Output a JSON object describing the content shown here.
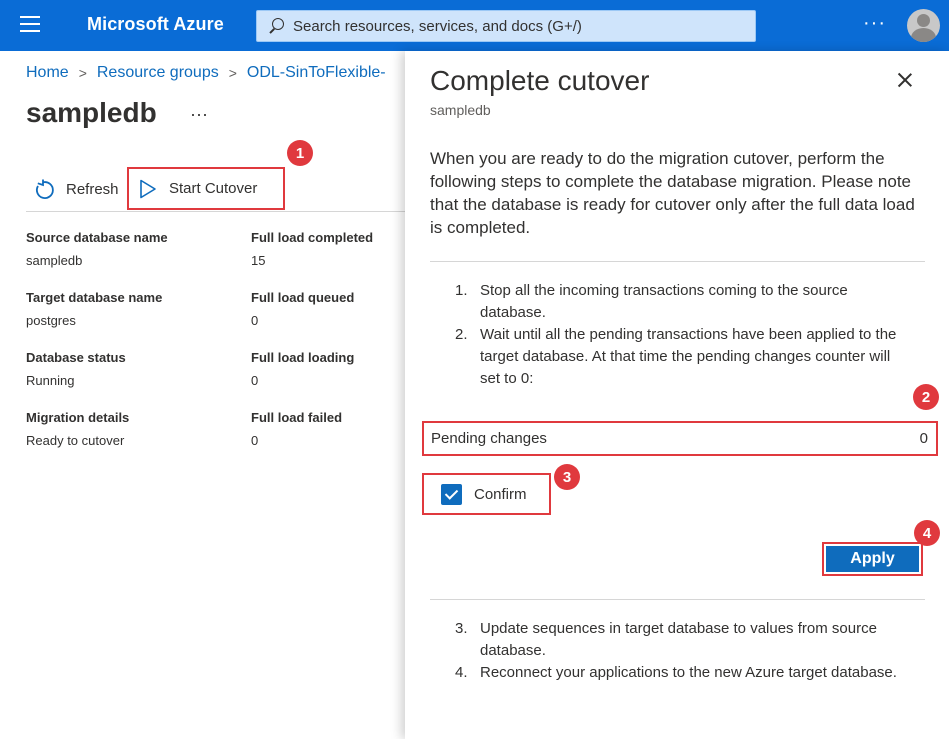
{
  "topbar": {
    "brand": "Microsoft Azure",
    "search_placeholder": "Search resources, services, and docs (G+/)",
    "more": "···"
  },
  "breadcrumb": [
    "Home",
    "Resource groups",
    "ODL-SinToFlexible-"
  ],
  "page": {
    "title": "sampledb",
    "more": "···"
  },
  "toolbar": {
    "refresh": "Refresh",
    "start_cutover": "Start Cutover"
  },
  "details": {
    "left": [
      {
        "label": "Source database name",
        "value": "sampledb"
      },
      {
        "label": "Target database name",
        "value": "postgres"
      },
      {
        "label": "Database status",
        "value": "Running"
      },
      {
        "label": "Migration details",
        "value": "Ready to cutover"
      }
    ],
    "right": [
      {
        "label": "Full load completed",
        "value": "15"
      },
      {
        "label": "Full load queued",
        "value": "0"
      },
      {
        "label": "Full load loading",
        "value": "0"
      },
      {
        "label": "Full load failed",
        "value": "0"
      }
    ]
  },
  "panel": {
    "title": "Complete cutover",
    "subtitle": "sampledb",
    "intro": "When you are ready to do the migration cutover, perform the following steps to complete the database migration. Please note that the database is ready for cutover only after the full data load is completed.",
    "steps_a": [
      {
        "num": "1.",
        "text": "Stop all the incoming transactions coming to the source database."
      },
      {
        "num": "2.",
        "text": "Wait until all the pending transactions have been applied to the target database. At that time the pending changes counter will set to 0:"
      }
    ],
    "pending_label": "Pending changes",
    "pending_value": "0",
    "confirm_label": "Confirm",
    "apply_label": "Apply",
    "steps_b": [
      {
        "num": "3.",
        "text": "Update sequences in target database to values from source database."
      },
      {
        "num": "4.",
        "text": "Reconnect your applications to the new Azure target database."
      }
    ]
  },
  "badges": [
    "1",
    "2",
    "3",
    "4"
  ]
}
